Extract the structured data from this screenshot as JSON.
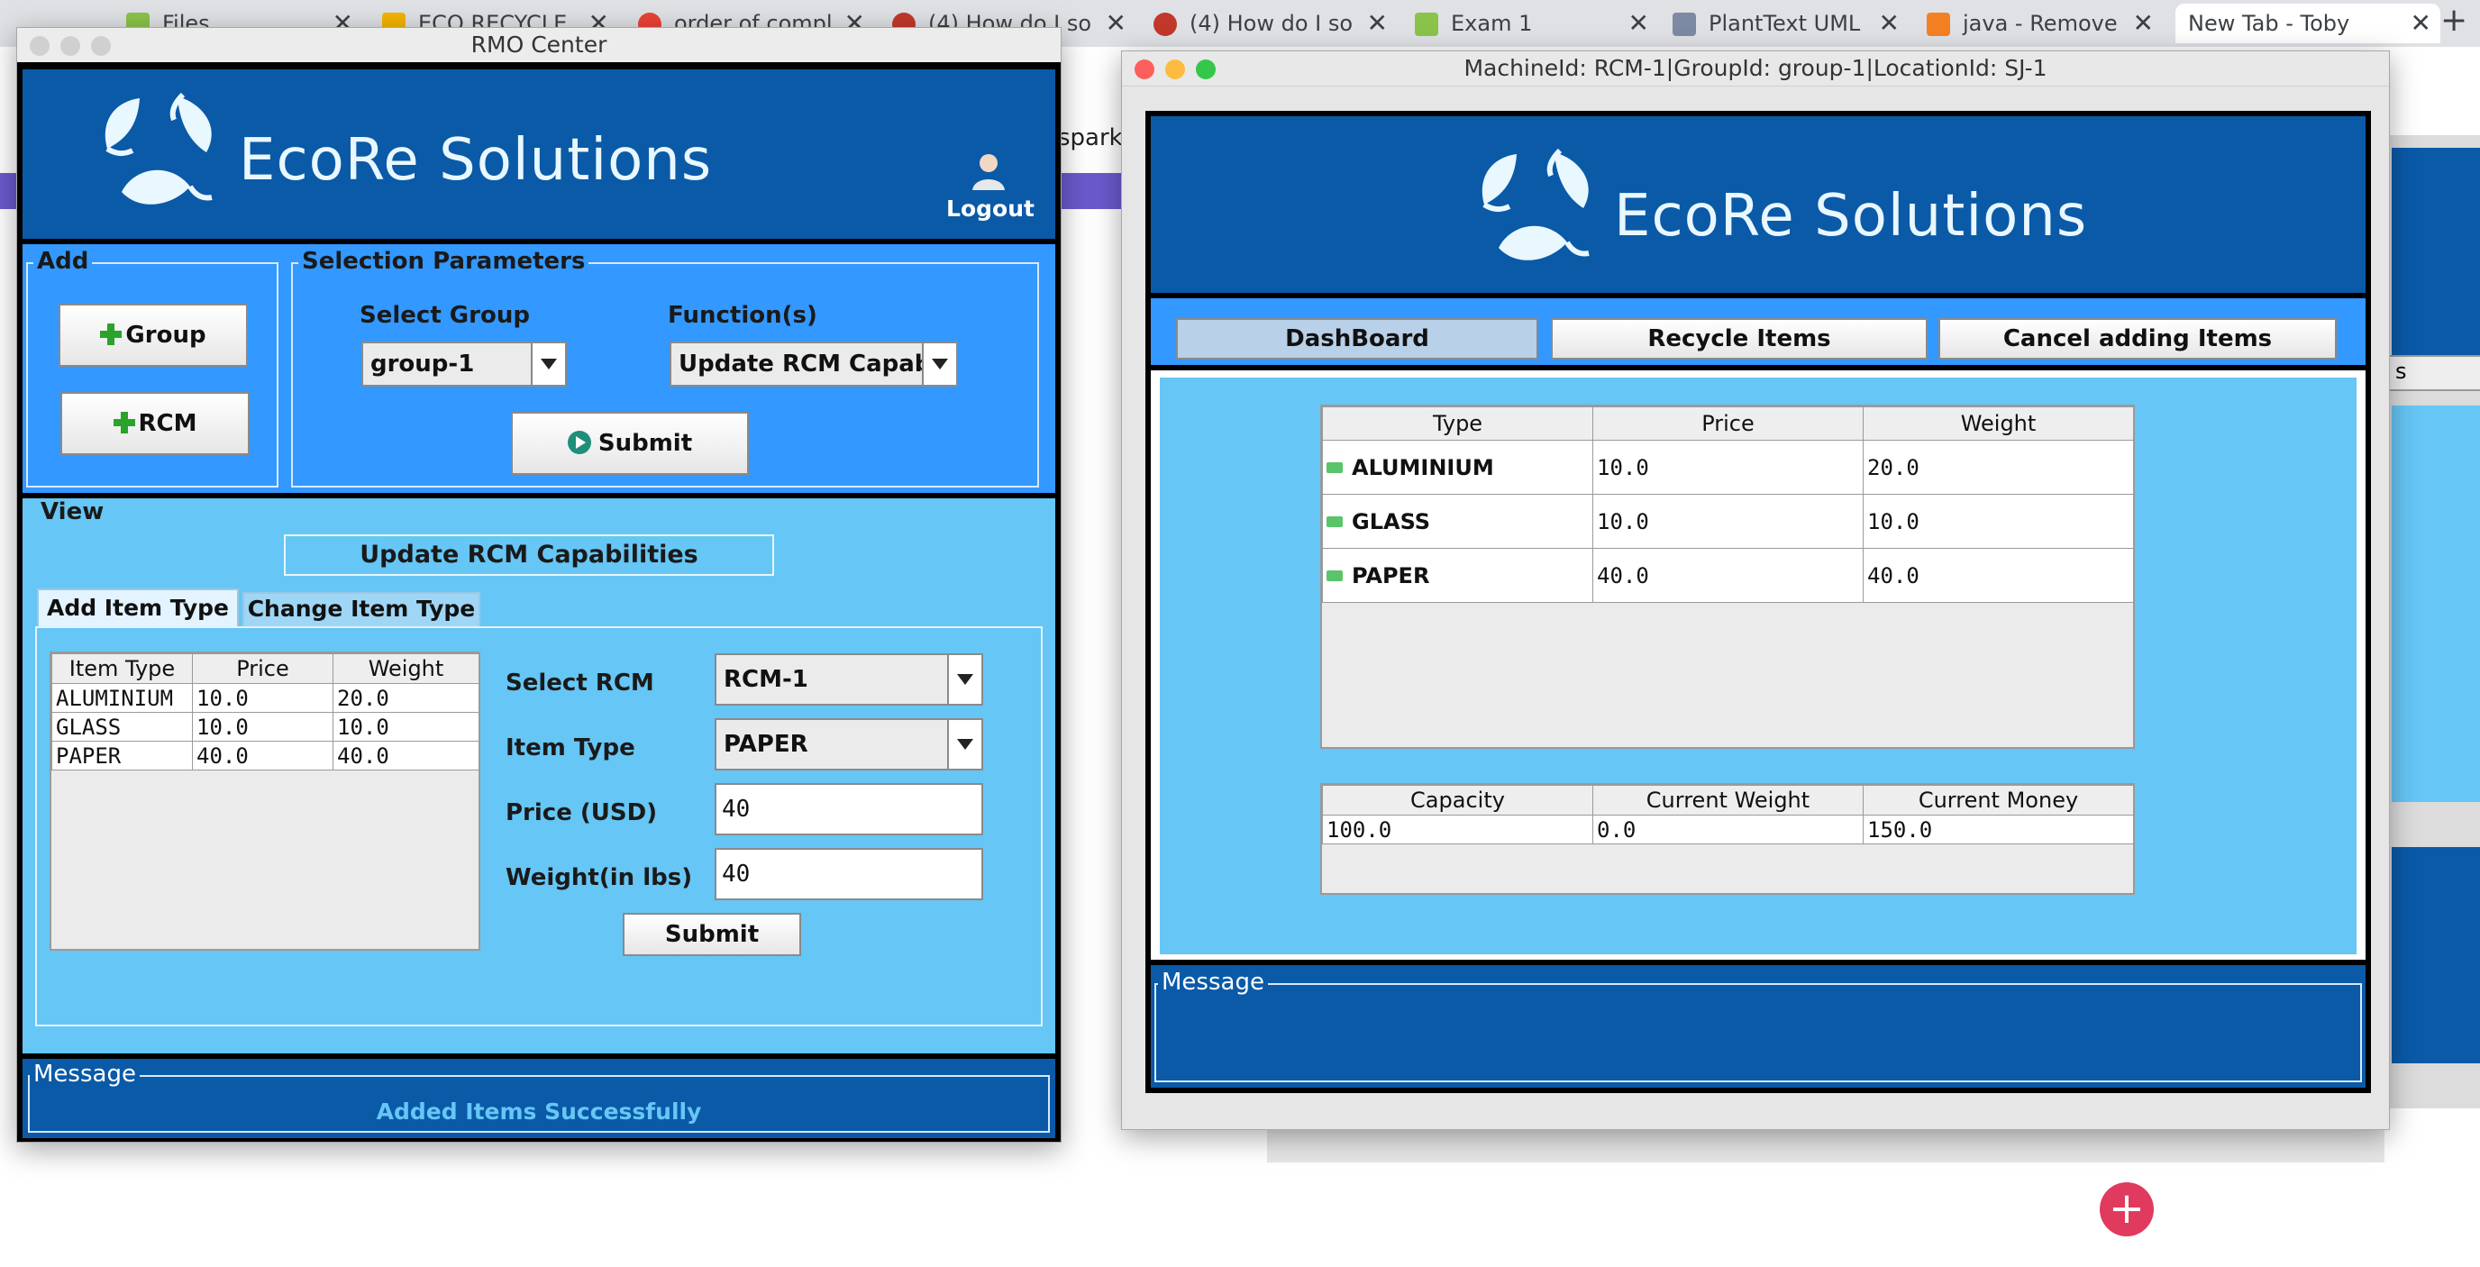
{
  "browser": {
    "tabs": [
      {
        "label": "Files"
      },
      {
        "label": "ECO RECYCLE"
      },
      {
        "label": "order of compl"
      },
      {
        "label": "(4) How do I so"
      },
      {
        "label": "(4) How do I so"
      },
      {
        "label": "Exam 1"
      },
      {
        "label": "PlantText UML"
      },
      {
        "label": "java - Remove"
      },
      {
        "label": "New Tab - Toby"
      }
    ],
    "new_tab": "+",
    "page_fragment": "sparkj"
  },
  "rmo": {
    "window_title": "RMO Center",
    "brand": "EcoRe Solutions",
    "logout_label": "Logout",
    "add": {
      "title": "Add",
      "group_button": "Group",
      "rcm_button": "RCM"
    },
    "selection": {
      "title": "Selection Parameters",
      "group_label": "Select Group",
      "group_value": "group-1",
      "function_label": "Function(s)",
      "function_value": "Update RCM Capabi...",
      "submit_label": "Submit"
    },
    "view": {
      "title": "View",
      "heading": "Update RCM Capabilities",
      "tabs": [
        "Add Item Type",
        "Change Item Type"
      ],
      "active_tab": 0,
      "table": {
        "columns": [
          "Item Type",
          "Price",
          "Weight"
        ],
        "rows": [
          [
            "ALUMINIUM",
            "10.0",
            "20.0"
          ],
          [
            "GLASS",
            "10.0",
            "10.0"
          ],
          [
            "PAPER",
            "40.0",
            "40.0"
          ]
        ]
      },
      "form": {
        "rcm_label": "Select RCM",
        "rcm_value": "RCM-1",
        "item_type_label": "Item Type",
        "item_type_value": "PAPER",
        "price_label": "Price (USD)",
        "price_value": "40",
        "weight_label": "Weight(in lbs)",
        "weight_value": "40",
        "submit_label": "Submit"
      }
    },
    "message": {
      "title": "Message",
      "text": "Added Items Successfully",
      "color": "#66c6f5"
    }
  },
  "rcm": {
    "window_title": "MachineId: RCM-1|GroupId: group-1|LocationId: SJ-1",
    "brand": "EcoRe Solutions",
    "tabs": [
      "DashBoard",
      "Recycle Items",
      "Cancel adding Items"
    ],
    "items_table": {
      "columns": [
        "Type",
        "Price",
        "Weight"
      ],
      "rows": [
        [
          "ALUMINIUM",
          "10.0",
          "20.0"
        ],
        [
          "GLASS",
          "10.0",
          "10.0"
        ],
        [
          "PAPER",
          "40.0",
          "40.0"
        ]
      ]
    },
    "status_table": {
      "columns": [
        "Capacity",
        "Current Weight",
        "Current Money"
      ],
      "rows": [
        [
          "100.0",
          "0.0",
          "150.0"
        ]
      ]
    },
    "message": {
      "title": "Message",
      "text": ""
    }
  },
  "colors": {
    "dark_blue": "#0a5aa8",
    "mid_blue": "#3398ff",
    "light_blue": "#66c6f5",
    "success_text": "#66c6f5"
  }
}
